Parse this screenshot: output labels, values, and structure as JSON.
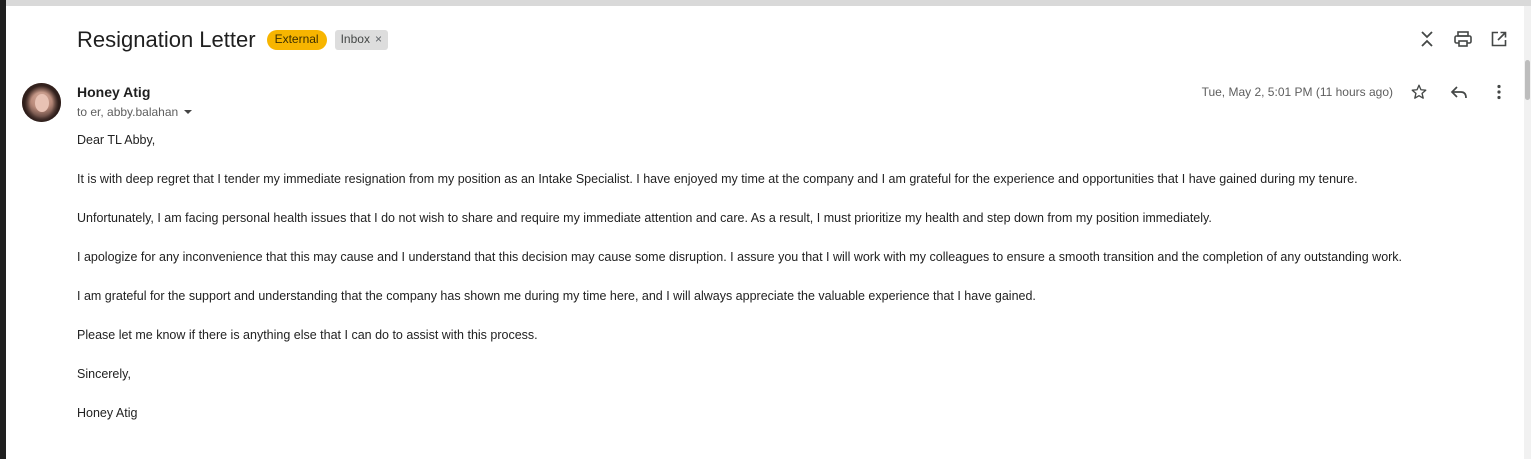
{
  "email": {
    "subject": "Resignation Letter",
    "labels": {
      "external": "External",
      "inbox": "Inbox",
      "remove": "×"
    },
    "sender": {
      "name": "Honey Atig",
      "recipients": "to er, abby.balahan"
    },
    "date": "Tue, May 2, 5:01 PM (11 hours ago)",
    "body": {
      "greeting": "Dear TL Abby,",
      "p1": "It is with deep regret that I tender my immediate resignation from my position as an Intake Specialist. I have enjoyed my time at the company and I am grateful for the experience and opportunities that I have gained during my tenure.",
      "p2": "Unfortunately, I am facing personal health issues that I do not wish to share and require my immediate attention and care. As a result, I must prioritize my health and step down from my position immediately.",
      "p3": "I apologize for any inconvenience that this may cause and I understand that this decision may cause some disruption. I assure you that I will work with my colleagues to ensure a smooth transition and the completion of any outstanding work.",
      "p4": "I am grateful for the support and understanding that the company has shown me during my time here, and I will always appreciate the valuable experience that I have gained.",
      "p5": "Please let me know if there is anything else that I can do to assist with this process.",
      "closing": "Sincerely,",
      "signature": "Honey Atig"
    }
  },
  "icons": {
    "collapse": "collapse-icon",
    "print": "print-icon",
    "open_new_window": "open-in-new-window-icon",
    "star": "star-icon",
    "reply": "reply-icon",
    "more": "more-vert-icon"
  },
  "colors": {
    "external_label": "#f7b500",
    "inbox_label": "#dddddd"
  }
}
